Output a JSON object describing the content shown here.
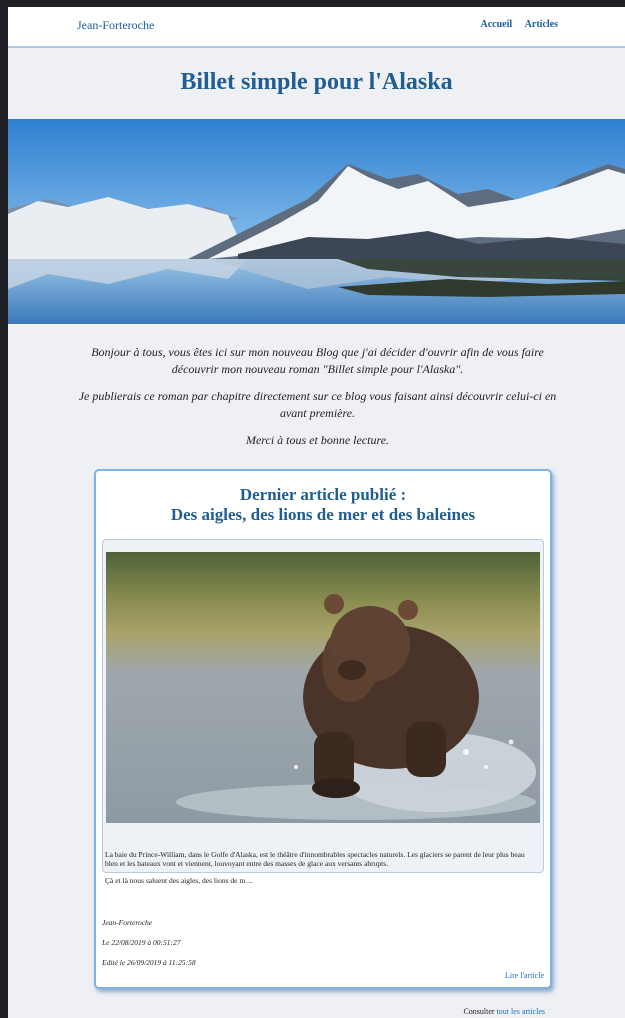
{
  "navbar": {
    "brand": "Jean-Forteroche",
    "links": [
      "Accueil",
      "Articles"
    ]
  },
  "page_title": "Billet simple pour l'Alaska",
  "intro": {
    "p1": "Bonjour à tous, vous êtes ici sur mon nouveau Blog que j'ai décider d'ouvrir afin de vous faire découvrir mon nouveau roman \"Billet simple pour l'Alaska\".",
    "p2": "Je publierais ce roman par chapitre directement sur ce blog vous faisant ainsi découvrir celui-ci en avant première.",
    "p3": "Merci à tous et bonne lecture."
  },
  "latest": {
    "heading_line1": "Dernier article publié :",
    "heading_line2": "Des aigles, des lions de mer et des baleines",
    "excerpt_p1": "La baie du Prince-William, dans le Golfe d'Alaska, est le théâtre d'innombrables spectacles naturels. Les glaciers se parent de leur plus beau bleu et les bateaux vont et viennent, louvoyant entre des masses de glace aux versants abrupts.",
    "excerpt_p2": "Çà et là nous saluent des aigles, des lions de m ...",
    "author": "Jean-Forteroche",
    "date_published": "Le 22/08/2019 à 00:51:27",
    "date_edited": "Edité le 26/09/2019 à 11:25:58",
    "read_more": "Lire l'article"
  },
  "footer": {
    "consult_prefix": "Consulter",
    "consult_link": "tout les articles"
  },
  "colors": {
    "accent": "#1f5d93",
    "link": "#1c6fc2",
    "background": "#eef0f4"
  }
}
